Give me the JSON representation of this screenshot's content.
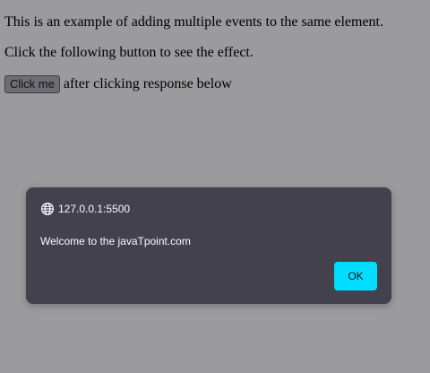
{
  "content": {
    "line1": "This is an example of adding multiple events to the same element.",
    "line2": "Click the following button to see the effect.",
    "button_label": "Click me",
    "after_button_text": "after clicking response below"
  },
  "alert": {
    "origin_icon": "globe-icon",
    "origin": "127.0.0.1:5500",
    "message": "Welcome to the javaTpoint.com",
    "ok_label": "OK"
  },
  "colors": {
    "page_background": "#9b9a9c",
    "dialog_background": "#42414d",
    "ok_button": "#00ddff"
  }
}
